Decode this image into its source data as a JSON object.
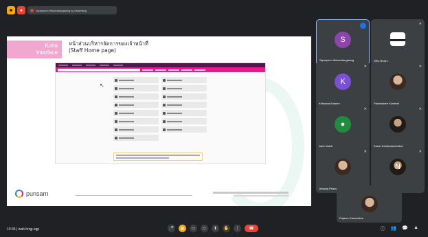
{
  "topbar": {
    "presenting_text": "Siyasphon Wanichiangsiang is presenting"
  },
  "slide": {
    "koha_line1": "Koha",
    "koha_line2": "Interface",
    "title_thai": "หน้าส่วนบริหารจัดการของเจ้าหน้าที่",
    "title_sub": "(Staff Home page)",
    "brand": "punsarn"
  },
  "participants": [
    {
      "name": "Siyasphon Wanichiangsiang",
      "initial": "S",
      "avatar_color": "#8e44ad"
    },
    {
      "name": "SRU library",
      "initial": "",
      "avatar_color": "#ffffff"
    },
    {
      "name": "Kritsrapat Kasem",
      "initial": "K",
      "avatar_color": "#7b4fd6"
    },
    {
      "name": "Papinwaree Kuntimit",
      "initial": "",
      "avatar_color": ""
    },
    {
      "name": "Jarin Intarit",
      "initial": "",
      "avatar_color": "#1e8e3e"
    },
    {
      "name": "Karan Kanthawanichkul",
      "initial": "",
      "avatar_color": ""
    },
    {
      "name": "Jetsada Phaiva",
      "initial": "",
      "avatar_color": ""
    },
    {
      "name": "Ari-Ai Nai",
      "initial": "N",
      "avatar_color": ""
    },
    {
      "name": "Pajaree Kanuchitee",
      "initial": "",
      "avatar_color": ""
    }
  ],
  "bottombar": {
    "meeting_info": "10:35 | wab-hrqg-sgp"
  },
  "icons": {
    "mic": "🎤",
    "camera": "▣",
    "captions": "▭",
    "reaction": "☺",
    "present": "⬆",
    "hand": "✋",
    "more": "⋮",
    "end": "☎",
    "info": "ⓘ",
    "people": "👥",
    "chat": "💬",
    "activities": "▲"
  }
}
